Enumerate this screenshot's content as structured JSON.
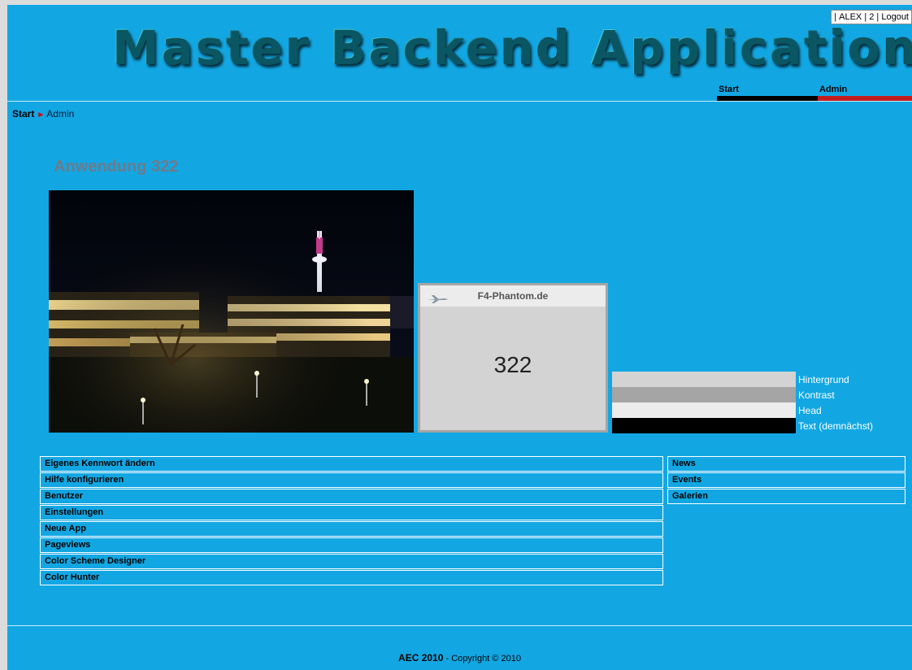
{
  "header": {
    "title_part1": "Master",
    "title_part2": "Backend",
    "title_part3": "Application",
    "user_bar": {
      "sep1": "|",
      "user": "ALEX",
      "sep2": "|",
      "count": "2",
      "sep3": "|",
      "logout": "Logout"
    }
  },
  "nav": {
    "tabs": [
      {
        "label": "Start"
      },
      {
        "label": "Admin"
      }
    ]
  },
  "breadcrumb": {
    "start": "Start",
    "current": "Admin"
  },
  "app": {
    "title": "Anwendung 322"
  },
  "preview": {
    "site_name": "F4-Phantom.de",
    "app_number": "322"
  },
  "color_scheme": [
    {
      "label": "Hintergrund",
      "color": "#d3d3d3"
    },
    {
      "label": "Kontrast",
      "color": "#a5a5a5"
    },
    {
      "label": "Head",
      "color": "#ececec"
    },
    {
      "label": "Text (demnächst)",
      "color": "#000000"
    }
  ],
  "menu_left": [
    {
      "label": "Eigenes Kennwort ändern"
    },
    {
      "label": "Hilfe konfigurieren"
    },
    {
      "label": "Benutzer"
    },
    {
      "label": "Einstellungen"
    },
    {
      "label": "Neue App"
    },
    {
      "label": "Pageviews"
    },
    {
      "label": "Color Scheme Designer"
    },
    {
      "label": "Color Hunter"
    }
  ],
  "menu_right": [
    {
      "label": "News"
    },
    {
      "label": "Events"
    },
    {
      "label": "Galerien"
    }
  ],
  "footer": {
    "brand": "AEC 2010",
    "copyright": "- Copyright © 2010"
  },
  "colors": {
    "page_bg": "#12a7e3",
    "active_tab": "#c41d1d",
    "tab_bar": "#000000"
  }
}
